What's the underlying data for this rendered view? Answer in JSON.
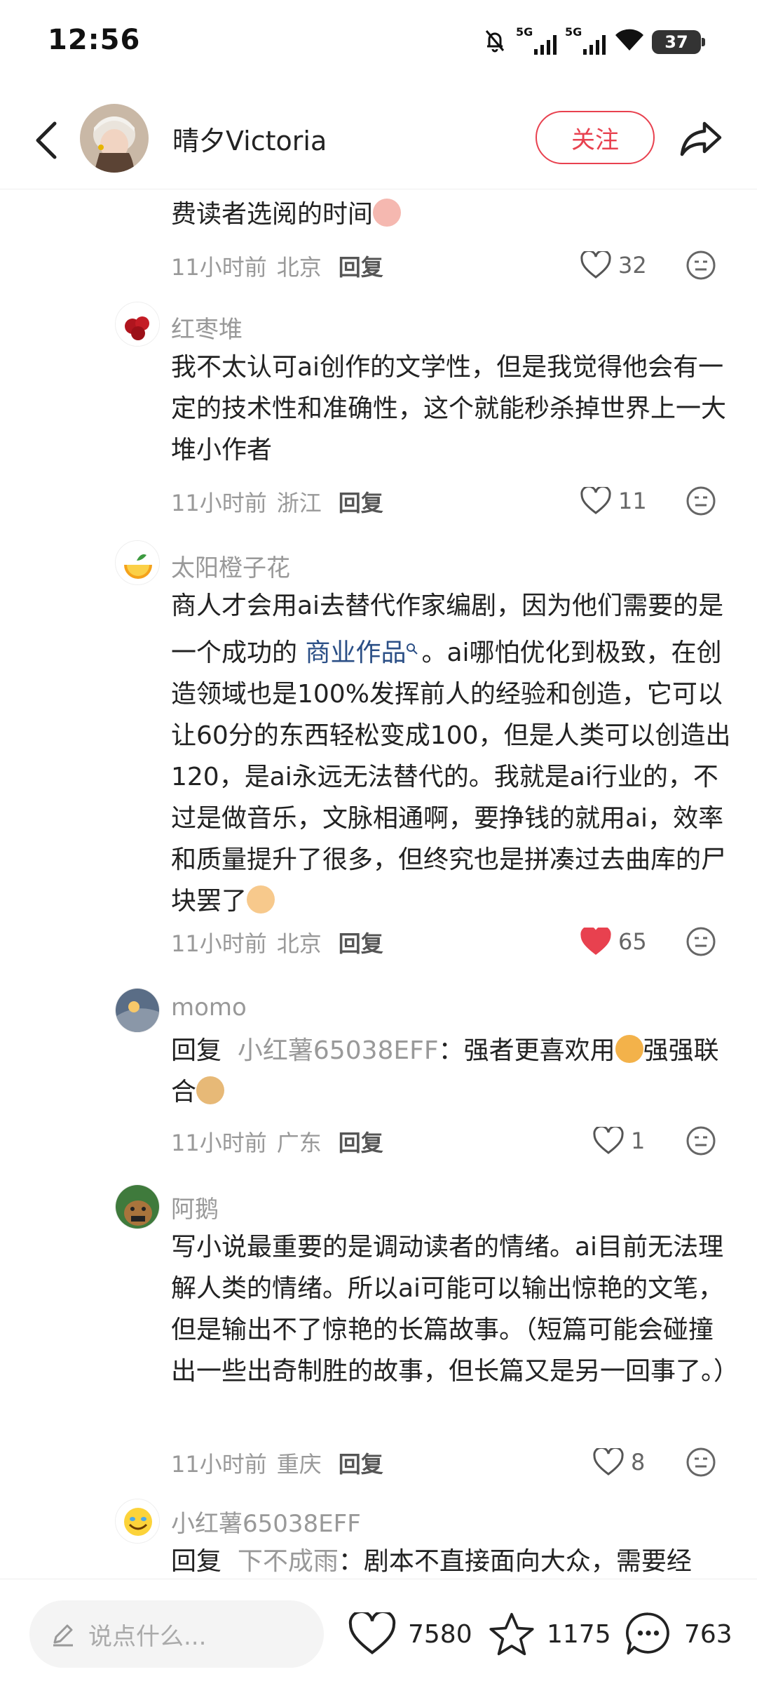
{
  "status_bar": {
    "time": "12:56",
    "network_1": "5G",
    "network_2": "5G",
    "battery": "37"
  },
  "header": {
    "username": "晴夕Victoria",
    "follow_label": "关注"
  },
  "comments": [
    {
      "text": "费读者选阅的时间",
      "time": "11小时前",
      "location": "北京",
      "reply_label": "回复",
      "likes": "32"
    },
    {
      "user": "红枣堆",
      "text": "我不太认可ai创作的文学性，但是我觉得他会有一定的技术性和准确性，这个就能秒杀掉世界上一大堆小作者",
      "time": "11小时前",
      "location": "浙江",
      "reply_label": "回复",
      "likes": "11"
    },
    {
      "user": "太阳橙子花",
      "text_a": "商人才会用ai去替代作家编剧，因为他们需要的是一个成功的 ",
      "link": "商业作品",
      "text_b": "。ai哪怕优化到极致，在创造领域也是100%发挥前人的经验和创造，它可以让60分的东西轻松变成100，但是人类可以创造出120，是ai永远无法替代的。我就是ai行业的，不过是做音乐，文脉相通啊，要挣钱的就用ai，效率和质量提升了很多，但终究也是拼凑过去曲库的尸块罢了",
      "time": "11小时前",
      "location": "北京",
      "reply_label": "回复",
      "likes": "65"
    },
    {
      "user": "momo",
      "reply_word": "回复",
      "reply_to": "小红薯65038EFF",
      "text_a": "：强者更喜欢用",
      "text_b": "强强联合",
      "time": "11小时前",
      "location": "广东",
      "reply_label": "回复",
      "likes": "1"
    },
    {
      "user": "阿鹅",
      "text": "写小说最重要的是调动读者的情绪。ai目前无法理解人类的情绪。所以ai可能可以输出惊艳的文笔，但是输出不了惊艳的长篇故事。（短篇可能会碰撞出一些出奇制胜的故事，但长篇又是另一回事了。）",
      "time": "11小时前",
      "location": "重庆",
      "reply_label": "回复",
      "likes": "8"
    },
    {
      "user": "小红薯65038EFF",
      "reply_word": "回复",
      "reply_to": "下不成雨",
      "text": "：剧本不直接面向大众，需要经"
    }
  ],
  "bottom_bar": {
    "input_placeholder": "说点什么...",
    "likes": "7580",
    "collects": "1175",
    "comments": "763"
  },
  "colors": {
    "accent": "#e8414f",
    "link": "#2b4f86",
    "muted": "#999999"
  }
}
